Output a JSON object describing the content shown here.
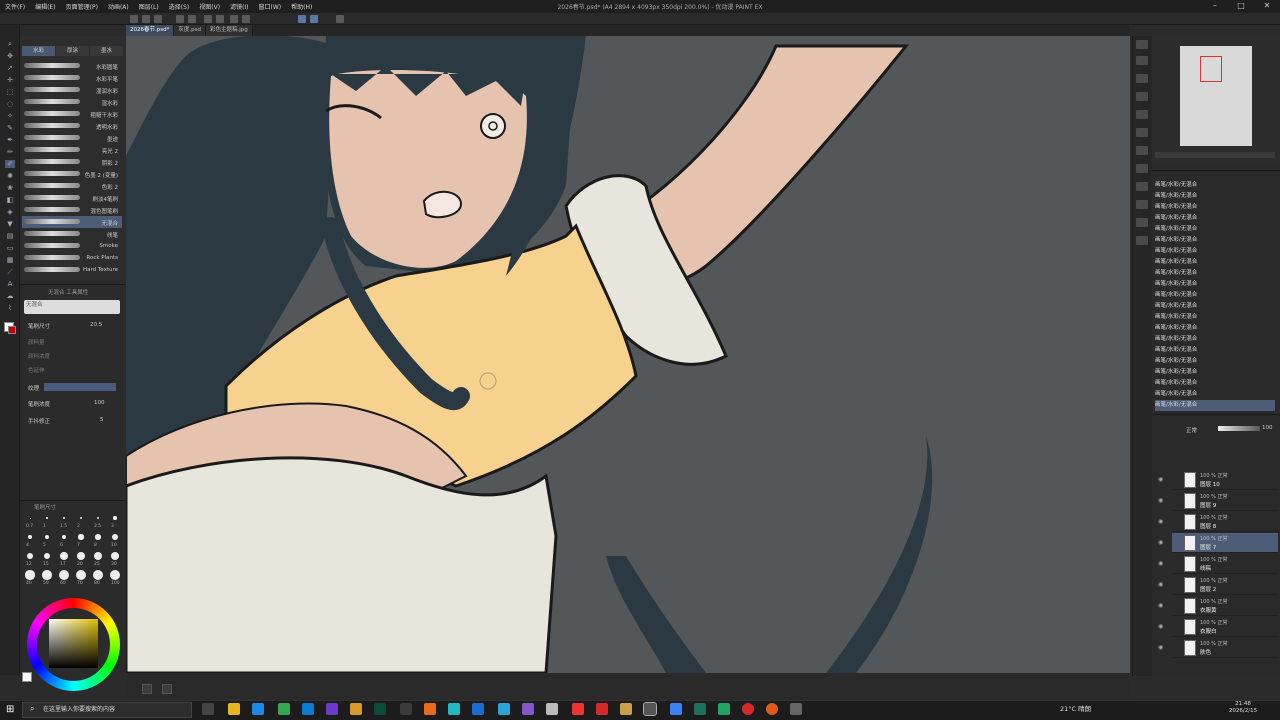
{
  "menu": [
    "文件(F)",
    "编辑(E)",
    "页面管理(P)",
    "动画(A)",
    "图层(L)",
    "选择(S)",
    "视图(V)",
    "滤镜(I)",
    "窗口(W)",
    "帮助(H)"
  ],
  "document_title": "2026春节.psd* (A4 2894 x 4093px 350dpi 200.0%) - 优动漫 PAINT EX",
  "tabs": [
    "2026春节.psd*",
    "灰度.psd",
    "彩色主题稿.jpg"
  ],
  "subtool": {
    "tabs": [
      "水彩",
      "厚涂",
      "墨水"
    ],
    "brushes": [
      "水彩圆笔",
      "水彩平笔",
      "湿润水彩",
      "湿水彩",
      "粗糙干水彩",
      "透明水彩",
      "墨迹",
      "亮光 2",
      "阴影 2",
      "色墨 2 (变量)",
      "色彩 2",
      "刷淡4笔刷",
      "混色图笔刷",
      "无混合",
      "线笔",
      "Smoke",
      "Rock Plants",
      "Hard Texture"
    ],
    "selected": "无混合"
  },
  "tool_property": {
    "title": "无混合 工具属性",
    "brush_label": "无混合",
    "size_label": "笔刷尺寸",
    "size_value": "20.5",
    "rows": [
      "颜料量",
      "颜料浓度",
      "色延伸"
    ],
    "texture_label": "纹理",
    "density_label": "笔刷浓度",
    "density_value": "100",
    "stabilizer_label": "手抖修正",
    "stabilizer_value": "5"
  },
  "brush_size": {
    "title": "笔刷尺寸",
    "values": [
      "0.7",
      "1",
      "1.5",
      "2",
      "2.5",
      "3",
      "4",
      "5",
      "6",
      "7",
      "8",
      "10",
      "12",
      "15",
      "17",
      "20",
      "25",
      "30",
      "40",
      "50",
      "60",
      "70",
      "80",
      "100"
    ]
  },
  "history_rows": [
    "画笔/水彩/无混合",
    "画笔/水彩/无混合",
    "画笔/水彩/无混合",
    "画笔/水彩/无混合",
    "画笔/水彩/无混合",
    "画笔/水彩/无混合",
    "画笔/水彩/无混合",
    "画笔/水彩/无混合",
    "画笔/水彩/无混合",
    "画笔/水彩/无混合",
    "画笔/水彩/无混合",
    "画笔/水彩/无混合",
    "画笔/水彩/无混合",
    "画笔/水彩/无混合",
    "画笔/水彩/无混合",
    "画笔/水彩/无混合",
    "画笔/水彩/无混合",
    "画笔/水彩/无混合",
    "画笔/水彩/无混合",
    "画笔/水彩/无混合",
    "画笔/水彩/无混合"
  ],
  "layers": {
    "blend_mode": "正常",
    "opacity": "100",
    "rows": [
      {
        "top": "100 % 正常",
        "name": "图层 10"
      },
      {
        "top": "100 % 正常",
        "name": "图层 9"
      },
      {
        "top": "100 % 正常",
        "name": "图层 8"
      },
      {
        "top": "100 % 正常",
        "name": "图层 7"
      },
      {
        "top": "100 % 正常",
        "name": "线稿"
      },
      {
        "top": "100 % 正常",
        "name": "图层 2"
      },
      {
        "top": "100 % 正常",
        "name": "衣服黄"
      },
      {
        "top": "100 % 正常",
        "name": "衣服白"
      },
      {
        "top": "100 % 正常",
        "name": "肤色"
      }
    ],
    "selected_index": 3
  },
  "taskbar": {
    "search_placeholder": "在这里输入你要搜索的内容",
    "weather": "21°C 晴朗",
    "time": "21:48",
    "date": "2026/2/15"
  },
  "colors": {
    "accent": "#4d5d78",
    "canvas_bg": "#545759",
    "hair": "#2b3a42",
    "skin": "#e5c3ae",
    "dress_yellow": "#f6d28e",
    "dress_white": "#e8e5dd"
  }
}
